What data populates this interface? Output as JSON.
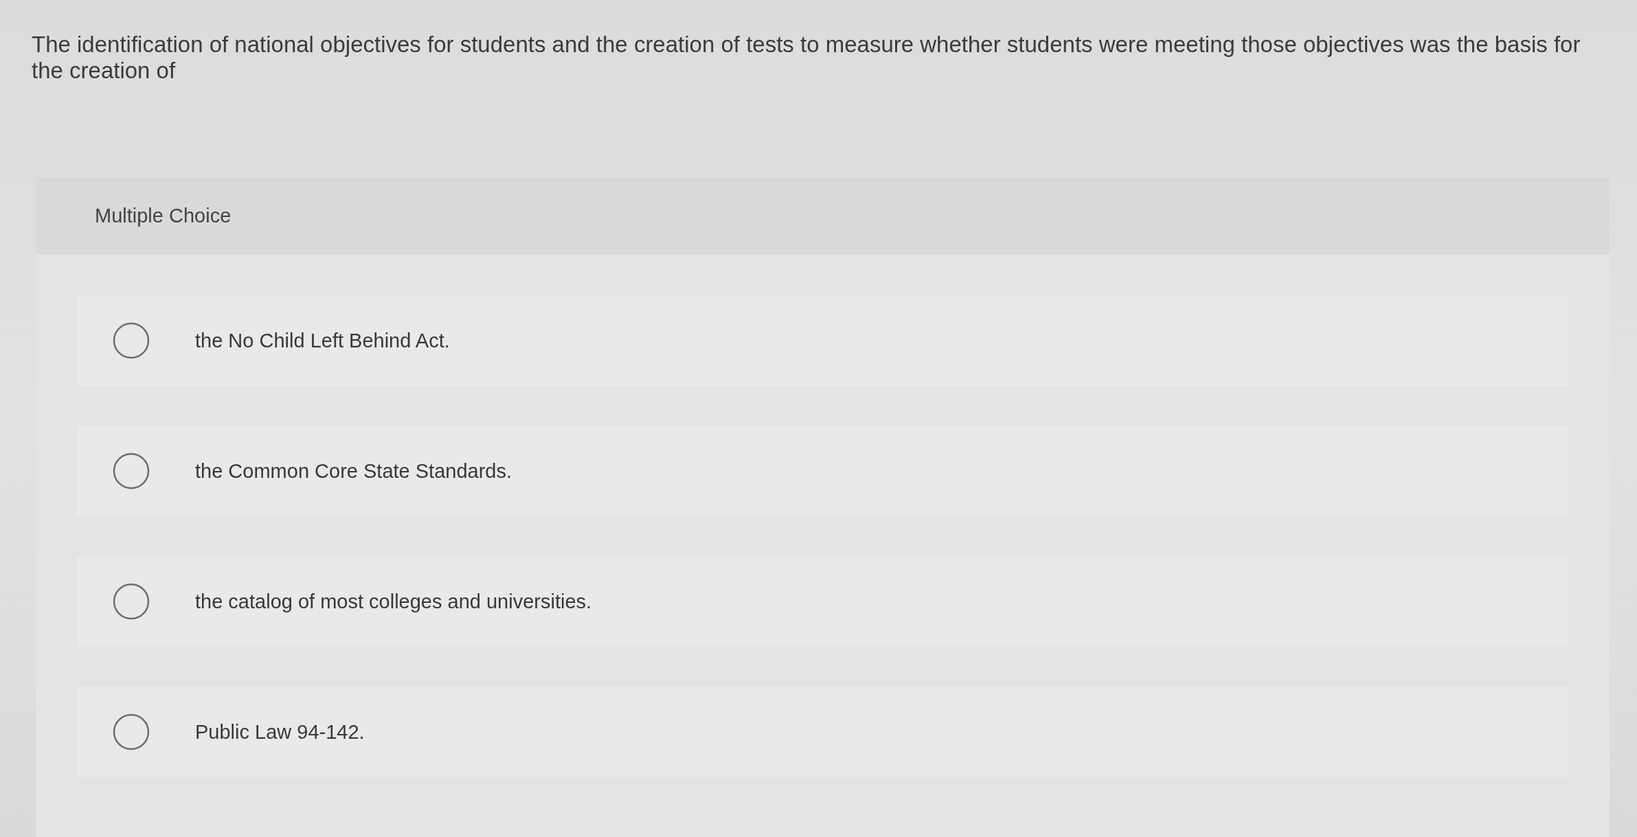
{
  "question": {
    "text": "The identification of national objectives for students and the creation of tests to measure whether students were meeting those objectives was the basis for the creation of"
  },
  "card": {
    "heading": "Multiple Choice"
  },
  "options": [
    {
      "label": "the No Child Left Behind Act.",
      "selected": false
    },
    {
      "label": "the Common Core State Standards.",
      "selected": false
    },
    {
      "label": "the catalog of most colleges and universities.",
      "selected": false
    },
    {
      "label": "Public Law 94-142.",
      "selected": false
    }
  ]
}
